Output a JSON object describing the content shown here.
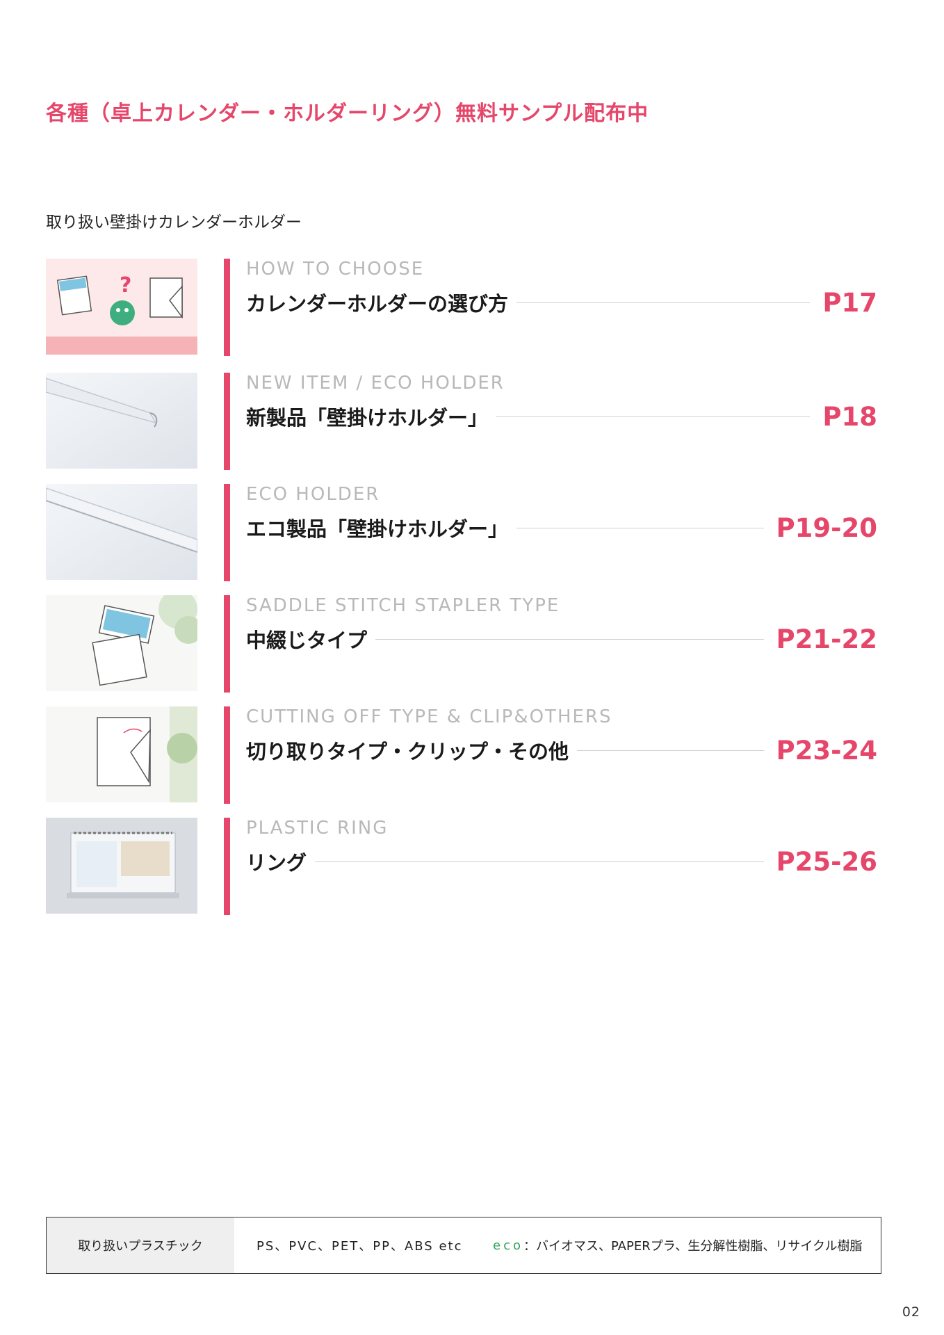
{
  "banner": "各種（卓上カレンダー・ホルダーリング）無料サンプル配布中",
  "subheading": "取り扱い壁掛けカレンダーホルダー",
  "entries": [
    {
      "en": "HOW TO CHOOSE",
      "jp": "カレンダーホルダーの選び方",
      "page": "P17"
    },
    {
      "en": "NEW ITEM /  ECO HOLDER",
      "jp": "新製品「壁掛けホルダー」",
      "page": "P18"
    },
    {
      "en": "ECO HOLDER",
      "jp": "エコ製品「壁掛けホルダー」",
      "page": "P19-20"
    },
    {
      "en": "SADDLE STITCH STAPLER TYPE",
      "jp": "中綴じタイプ",
      "page": "P21-22"
    },
    {
      "en": "CUTTING OFF TYPE & CLIP&OTHERS",
      "jp": "切り取りタイプ・クリップ・その他",
      "page": "P23-24"
    },
    {
      "en": "PLASTIC RING",
      "jp": "リング",
      "page": "P25-26"
    }
  ],
  "materials": {
    "label": "取り扱いプラスチック",
    "values": "PS、PVC、PET、PP、ABS etc",
    "eco_word": "eco",
    "eco_text": "：バイオマス、PAPERプラ、生分解性樹脂、リサイクル樹脂"
  },
  "page_number": "02",
  "colors": {
    "accent": "#e5466a",
    "eco": "#2ea55a"
  }
}
